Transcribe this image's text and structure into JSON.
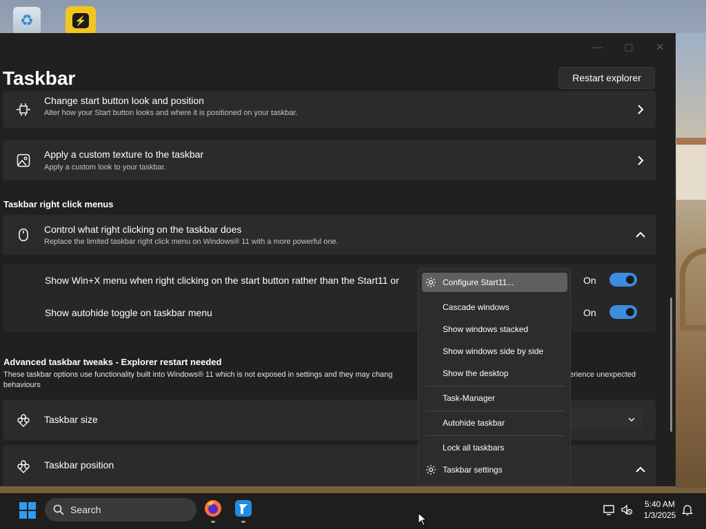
{
  "window": {
    "title": "Taskbar",
    "restart_button": "Restart explorer",
    "controls": {
      "minimize": "—",
      "maximize": "▢",
      "close": "✕"
    }
  },
  "cards": {
    "start_button": {
      "title": "Change start button look and position",
      "subtitle": "Alter how your Start button looks and where it is positioned on your taskbar."
    },
    "texture": {
      "title": "Apply a custom texture to the taskbar",
      "subtitle": "Apply a custom look to your taskbar."
    }
  },
  "right_click": {
    "section_label": "Taskbar right click menus",
    "title": "Control what right clicking on the taskbar does",
    "subtitle": "Replace the limited taskbar right click menu on Windows® 11 with a more powerful one.",
    "options": [
      {
        "label": "Show Win+X menu when right clicking on the start button rather than the Start11 or",
        "state": "On",
        "enabled": true
      },
      {
        "label": "Show autohide toggle on taskbar menu",
        "state": "On",
        "enabled": true
      }
    ]
  },
  "advanced": {
    "title": "Advanced taskbar tweaks - Explorer restart needed",
    "description_left": "These taskbar options use functionality built into Windows® 11 which is not exposed in settings and they may chang",
    "description_right": "erience unexpected",
    "description_line2": "behaviours",
    "size_label": "Taskbar size",
    "position_label": "Taskbar position"
  },
  "context_menu": {
    "items": [
      {
        "label": "Configure Start11...",
        "icon": "gear-icon",
        "highlighted": true
      },
      {
        "label": "Cascade windows"
      },
      {
        "label": "Show windows stacked"
      },
      {
        "label": "Show windows side by side"
      },
      {
        "label": "Show the desktop"
      },
      {
        "label": "Task-Manager"
      },
      {
        "label": "Autohide taskbar"
      },
      {
        "label": "Lock all taskbars"
      },
      {
        "label": "Taskbar settings",
        "icon": "gear-icon"
      }
    ]
  },
  "taskbar": {
    "search_placeholder": "Search",
    "time": "5:40 AM",
    "date": "1/3/2025",
    "apps": [
      "firefox-icon",
      "start11-icon"
    ]
  },
  "colors": {
    "accent": "#3c8ce0",
    "window_bg": "#202020",
    "card_bg": "#2b2b2b",
    "menu_bg": "#2c2c2c",
    "menu_highlight": "#5f5f5f",
    "taskbar_bg": "#1e1e1e"
  }
}
